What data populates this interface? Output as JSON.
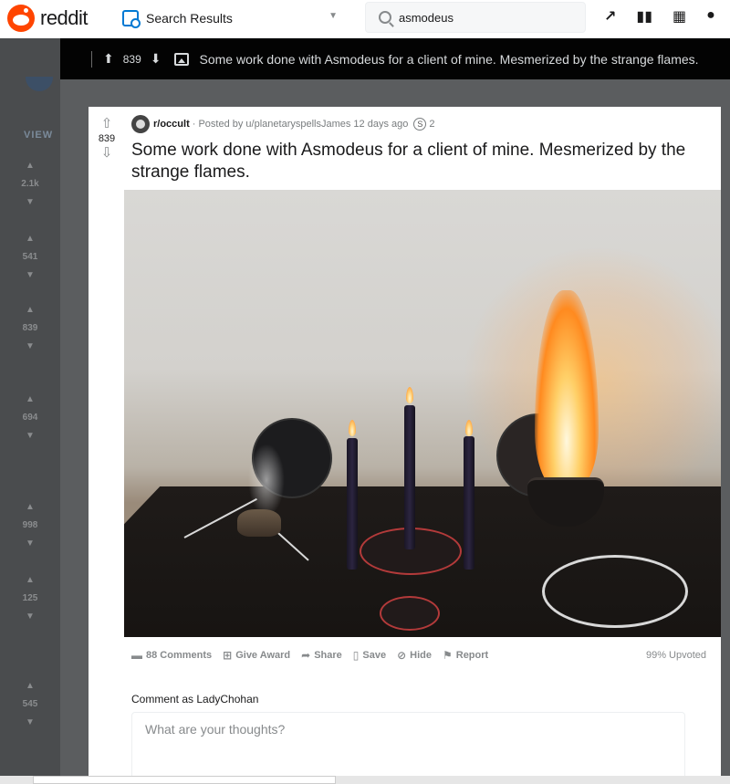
{
  "header": {
    "logo_text": "reddit",
    "home_dropdown_label": "Search Results",
    "search_value": "asmodeus",
    "icons": [
      "trending-icon",
      "stats-icon",
      "qr-icon",
      "chat-icon"
    ]
  },
  "left_strip": {
    "view_label": "VIEW",
    "scores": [
      "2.1k",
      "541",
      "839",
      "694",
      "998",
      "125",
      "545"
    ]
  },
  "post_bar": {
    "score": "839",
    "title": "Some work done with Asmodeus for a client of mine. Mesmerized by the strange flames."
  },
  "post": {
    "score": "839",
    "subreddit": "r/occult",
    "posted_by": "· Posted by u/planetaryspellsJames 12 days ago",
    "award_count": "2",
    "title": "Some work done with Asmodeus for a client of mine. Mesmerized by the strange flames.",
    "actions": {
      "comments": "88 Comments",
      "give_award": "Give Award",
      "share": "Share",
      "save": "Save",
      "hide": "Hide",
      "report": "Report"
    },
    "upvoted": "99% Upvoted"
  },
  "comment": {
    "comment_as": "Comment as LadyChohan",
    "placeholder": "What are your thoughts?"
  },
  "colors": {
    "brand": "#ff4500",
    "accent_blue": "#0079d3",
    "post_bar_bg": "#030303"
  }
}
